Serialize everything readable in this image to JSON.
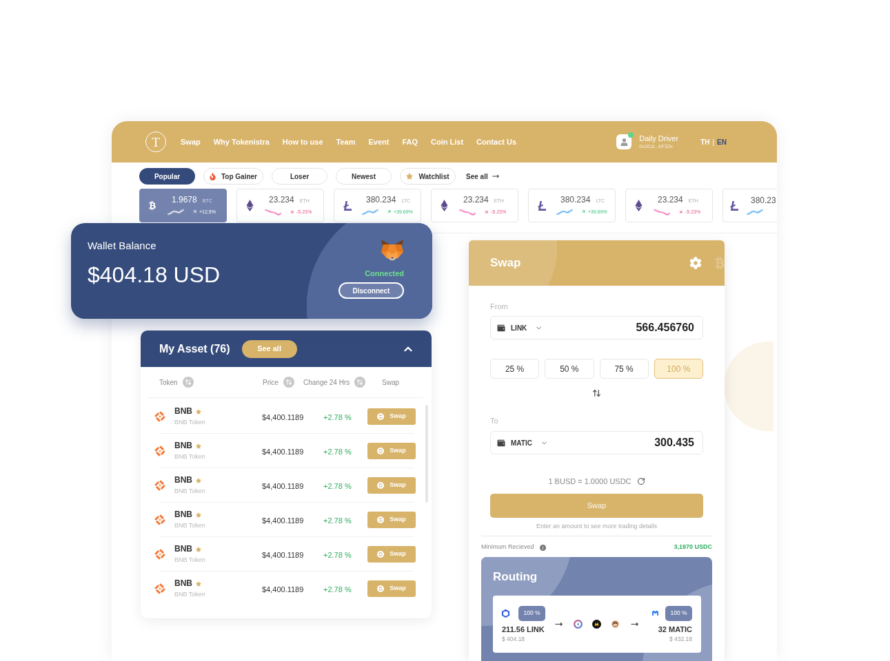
{
  "nav": {
    "logo": "T",
    "links": [
      "Swap",
      "Why Tokenistra",
      "How to use",
      "Team",
      "Event",
      "FAQ",
      "Coin List",
      "Contact Us"
    ],
    "user": {
      "name": "Daily Driver",
      "address": "0x3Cd...bF32x",
      "online": true
    },
    "languages": [
      {
        "label": "TH",
        "selected": false
      },
      {
        "label": "EN",
        "selected": true
      }
    ],
    "language_separator": "|"
  },
  "filter_tabs": [
    {
      "label": "Popular",
      "kind": "text",
      "selected": true
    },
    {
      "label": "Top Gainer",
      "kind": "fire",
      "selected": false
    },
    {
      "label": "Loser",
      "kind": "text",
      "selected": false
    },
    {
      "label": "Newest",
      "kind": "text",
      "selected": false
    },
    {
      "label": "Watchlist",
      "kind": "star",
      "selected": false
    }
  ],
  "see_all_link": "See all",
  "tickers": [
    {
      "kind": "btc",
      "value": "1.9678",
      "unit": "BTC",
      "rising": true,
      "change": "+12,5%",
      "selected": true
    },
    {
      "kind": "eth",
      "value": "23.234",
      "unit": "ETH",
      "rising": false,
      "change": "-5.23%",
      "selected": false
    },
    {
      "kind": "ltc",
      "value": "380.234",
      "unit": "LTC",
      "rising": true,
      "change": "+39.69%",
      "selected": false
    },
    {
      "kind": "eth",
      "value": "23.234",
      "unit": "ETH",
      "rising": false,
      "change": "-5.23%",
      "selected": false
    },
    {
      "kind": "ltc",
      "value": "380.234",
      "unit": "LTC",
      "rising": true,
      "change": "+39.69%",
      "selected": false
    },
    {
      "kind": "eth",
      "value": "23.234",
      "unit": "ETH",
      "rising": false,
      "change": "-5.23%",
      "selected": false
    },
    {
      "kind": "ltc",
      "value": "380.23",
      "rising": true,
      "selected": false
    }
  ],
  "wallet": {
    "title": "Wallet Balance",
    "balance": "$404.18 USD",
    "status": "Connected",
    "connected": true,
    "button": "Disconnect"
  },
  "assets": {
    "title": "My Asset (76)",
    "see_all": "See all",
    "expanded": true,
    "columns": [
      {
        "label": "Token",
        "sortable": true
      },
      {
        "label": "Price",
        "sortable": true
      },
      {
        "label": "Change 24 Hrs",
        "sortable": true
      },
      {
        "label": "Swap",
        "sortable": false
      }
    ],
    "rows": [
      {
        "symbol": "BNB",
        "name": "BNB Token",
        "starred": true,
        "price": "$4,400.1189",
        "change": "+2.78 %",
        "rising": true,
        "action": "Swap"
      },
      {
        "symbol": "BNB",
        "name": "BNB Token",
        "starred": true,
        "price": "$4,400.1189",
        "change": "+2.78 %",
        "rising": true,
        "action": "Swap"
      },
      {
        "symbol": "BNB",
        "name": "BNB Token",
        "starred": true,
        "price": "$4,400.1189",
        "change": "+2.78 %",
        "rising": true,
        "action": "Swap"
      },
      {
        "symbol": "BNB",
        "name": "BNB Token",
        "starred": true,
        "price": "$4,400.1189",
        "change": "+2.78 %",
        "rising": true,
        "action": "Swap"
      },
      {
        "symbol": "BNB",
        "name": "BNB Token",
        "starred": true,
        "price": "$4,400.1189",
        "change": "+2.78 %",
        "rising": true,
        "action": "Swap"
      },
      {
        "symbol": "BNB",
        "name": "BNB Token",
        "starred": true,
        "price": "$4,400.1189",
        "change": "+2.78 %",
        "rising": true,
        "action": "Swap"
      }
    ]
  },
  "swap": {
    "title": "Swap",
    "from": {
      "label": "From",
      "token": "LINK",
      "value": "566.456760"
    },
    "percentages": [
      {
        "label": "25 %",
        "selected": false
      },
      {
        "label": "50 %",
        "selected": false
      },
      {
        "label": "75 %",
        "selected": false
      },
      {
        "label": "100 %",
        "selected": true
      }
    ],
    "to": {
      "label": "To",
      "token": "MATIC",
      "value": "300.435"
    },
    "rate": "1 BUSD = 1.0000 USDC",
    "button": "Swap",
    "hint": "Enter an amount to see more trading details",
    "minimum": {
      "label": "Minimum Recieved",
      "value": "3,1970 USDC"
    },
    "routing": {
      "title": "Routing",
      "from": {
        "share": "100 %",
        "amount": "211.56 LINK",
        "value": "$ 404.18"
      },
      "to": {
        "share": "100 %",
        "amount": "32 MATIC",
        "value": "$ 432.18"
      }
    }
  }
}
